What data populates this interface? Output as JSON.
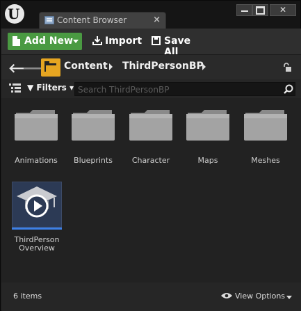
{
  "window": {
    "tab_title": "Content Browser",
    "minimize_label": "",
    "maximize_label": "",
    "close_label": "✕"
  },
  "toolbar": {
    "add_new_label": "Add New",
    "import_label": "Import",
    "save_all_label": "Save All"
  },
  "path": {
    "crumbs": [
      "Content",
      "ThirdPersonBP"
    ]
  },
  "filter": {
    "filters_label": "Filters",
    "search_placeholder": "Search ThirdPersonBP"
  },
  "folders": [
    {
      "name": "Animations"
    },
    {
      "name": "Blueprints"
    },
    {
      "name": "Character"
    },
    {
      "name": "Maps"
    },
    {
      "name": "Meshes"
    }
  ],
  "assets": [
    {
      "name_line1": "ThirdPerson",
      "name_line2": "Overview",
      "icon": "tutorial-play-icon",
      "accent": "#3c80e8"
    }
  ],
  "status": {
    "item_count": "6 items",
    "view_options_label": "View Options"
  },
  "colors": {
    "add_new": "#4a9a42",
    "folder_button": "#e6a521",
    "asset_accent": "#3c80e8"
  }
}
